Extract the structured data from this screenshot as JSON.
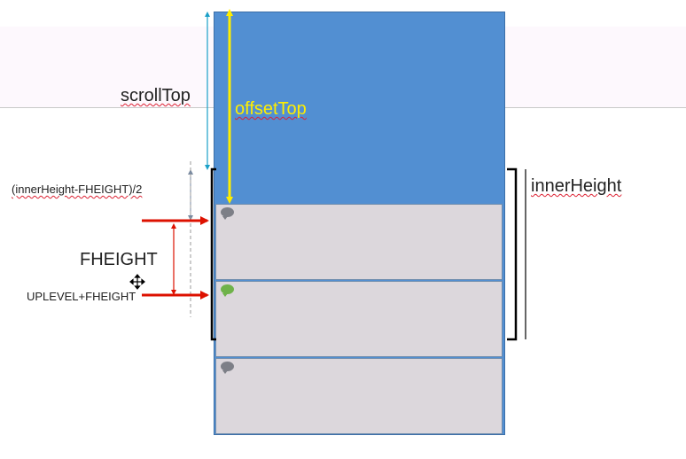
{
  "labels": {
    "scroll_top": "scrollTop",
    "offset_top": "offsetTop",
    "inner_height": "innerHeight",
    "center_formula": "(innerHeight-FHEIGHT)/2",
    "fheight": "FHEIGHT",
    "uplevel_fheight": "UPLEVEL+FHEIGHT"
  },
  "colors": {
    "container_blue": "#528fd2",
    "panel_gray": "#dcd7dc",
    "offset_arrow_yellow": "#ffee00",
    "scroll_arrow_cyan": "#1aa0c8",
    "pointer_red": "#dd1100",
    "dot_gray": "#7d7f87",
    "dot_green": "#6fb24a"
  },
  "icons": {
    "cursor": "move-cursor-icon",
    "panel_marker": "speech-bubble-icon"
  }
}
